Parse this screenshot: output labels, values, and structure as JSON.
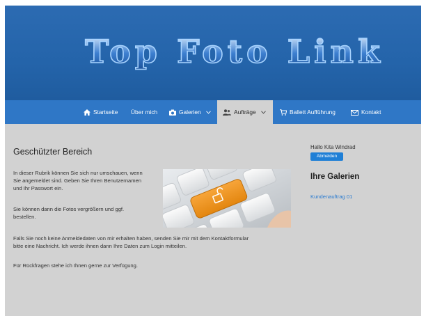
{
  "site": {
    "logo_text": "Top Foto Link"
  },
  "nav": {
    "items": [
      {
        "label": "Startseite",
        "icon": "home-icon"
      },
      {
        "label": "Über mich",
        "icon": ""
      },
      {
        "label": "Galerien",
        "icon": "camera-icon",
        "has_dropdown": true
      },
      {
        "label": "Aufträge",
        "icon": "users-icon",
        "has_dropdown": true,
        "active": true
      },
      {
        "label": "Ballett Aufführung",
        "icon": "cart-icon"
      },
      {
        "label": "Kontakt",
        "icon": "mail-icon"
      }
    ]
  },
  "main": {
    "title": "Geschützter Bereich",
    "paragraph1": [
      "In dieser Rubrik können Sie sich nur umschauen, wenn",
      "Sie angemeldet sind. Geben Sie Ihren Benutzernamen",
      "und Ihr Passwort ein."
    ],
    "paragraph2": [
      "Sie können dann die Fotos vergrößern und ggf.",
      "bestellen."
    ],
    "paragraph3": [
      "Falls Sie noch keine Anmeldedaten von mir erhalten haben, senden Sie mir mit dem Kontaktformular",
      "bitte eine Nachricht. Ich werde ihnen dann Ihre Daten zum Login mitteilen."
    ],
    "paragraph4": "Für Rückfragen stehe ich Ihnen gerne zur Verfügung."
  },
  "sidebar": {
    "greeting": "Hallo Kita Windrad",
    "logout_label": "Abmelden",
    "galleries_title": "Ihre Galerien",
    "gallery_link": "Kundenauftrag 01"
  },
  "colors": {
    "header": "#2464aa",
    "nav": "#2f77c6",
    "background": "#d2d2d2",
    "button": "#1f7fd6",
    "link": "#2a7bd0",
    "key_orange": "#f0961f"
  }
}
